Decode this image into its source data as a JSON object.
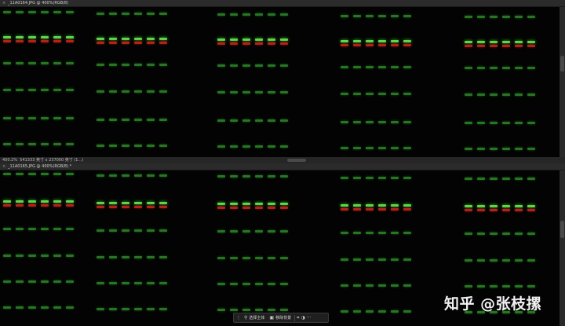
{
  "doc_top": {
    "tab_label": "_11A0164.JPG @ 400%(RGB/8)",
    "close_glyph": "×"
  },
  "doc_bottom": {
    "tab_label": "_11A0165.JPG @ 400%(RGB/8) *",
    "close_glyph": "×"
  },
  "status": {
    "zoom": "400.2%",
    "info": "541333 英寸 x 237000 英寸 (1...)"
  },
  "toolbar": {
    "select_subject_label": "选择主体",
    "remove_bg_label": "移除背景",
    "more_glyph": "···"
  },
  "watermark": {
    "text": "知乎 @张枝摞"
  },
  "colors": {
    "green": "#3fbf3a",
    "red": "#a81a12",
    "dim_green": "#2a7a26"
  }
}
